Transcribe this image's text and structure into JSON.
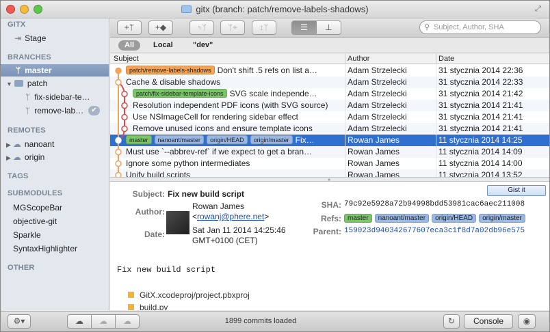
{
  "window": {
    "title": "gitx (branch: patch/remove-labels-shadows)"
  },
  "sidebar": {
    "app_header": "GITX",
    "stage": "Stage",
    "branches_header": "BRANCHES",
    "branches": [
      "master",
      "patch"
    ],
    "patch_children": [
      "fix-sidebar-te…",
      "remove-lab…"
    ],
    "remotes_header": "REMOTES",
    "remotes": [
      "nanoant",
      "origin"
    ],
    "tags_header": "TAGS",
    "submodules_header": "SUBMODULES",
    "submodules": [
      "MGScopeBar",
      "objective-git",
      "Sparkle",
      "SyntaxHighlighter"
    ],
    "other_header": "OTHER"
  },
  "search": {
    "placeholder": "Subject, Author, SHA"
  },
  "filters": {
    "all": "All",
    "local": "Local",
    "named": "\"dev\""
  },
  "columns": {
    "subject": "Subject",
    "author": "Author",
    "date": "Date"
  },
  "commits": [
    {
      "refs": [
        {
          "label": "patch/remove-labels-shadows",
          "color": "#f0a35b"
        }
      ],
      "subject": "Don't shift .5 refs on list a…",
      "author": "Adam Strzelecki",
      "date": "31 stycznia 2014 22:36"
    },
    {
      "refs": [],
      "subject": "Cache & disable shadows",
      "author": "Adam Strzelecki",
      "date": "31 stycznia 2014 22:33"
    },
    {
      "refs": [
        {
          "label": "patch/fix-sidebar-template-icons",
          "color": "#7cc46c"
        }
      ],
      "subject": "SVG scale independe…",
      "author": "Adam Strzelecki",
      "date": "31 stycznia 2014 21:42"
    },
    {
      "refs": [],
      "subject": "Resolution independent PDF icons (with SVG source)",
      "author": "Adam Strzelecki",
      "date": "31 stycznia 2014 21:41"
    },
    {
      "refs": [],
      "subject": "Use NSImageCell for rendering sidebar effect",
      "author": "Adam Strzelecki",
      "date": "31 stycznia 2014 21:41"
    },
    {
      "refs": [],
      "subject": "Remove unused icons and ensure template icons",
      "author": "Adam Strzelecki",
      "date": "31 stycznia 2014 21:41"
    },
    {
      "refs": [
        {
          "label": "master",
          "color": "#7cc46c"
        },
        {
          "label": "nanoant/master",
          "color": "#9ab8e2"
        },
        {
          "label": "origin/HEAD",
          "color": "#9ab8e2"
        },
        {
          "label": "origin/master",
          "color": "#9ab8e2"
        }
      ],
      "subject": "Fix…",
      "author": "Rowan James",
      "date": "11 stycznia 2014 14:25"
    },
    {
      "refs": [],
      "subject": "Must use `--abbrev-ref` if we expect to get a bran…",
      "author": "Rowan James",
      "date": "11 stycznia 2014 14:09"
    },
    {
      "refs": [],
      "subject": "Ignore some python intermediates",
      "author": "Rowan James",
      "date": "11 stycznia 2014 14:00"
    },
    {
      "refs": [],
      "subject": "Unify build scripts",
      "author": "Rowan James",
      "date": "11 stycznia 2014 13:52"
    }
  ],
  "detail": {
    "gist_button": "Gist it",
    "subject_label": "Subject:",
    "subject": "Fix new build script",
    "author_label": "Author:",
    "author_name": "Rowan James",
    "author_email_open": "<",
    "author_email": "rowanj@phere.net",
    "author_email_close": ">",
    "date_label": "Date:",
    "date_line1": "Sat Jan 11 2014 14:25:46",
    "date_line2": "GMT+0100 (CET)",
    "sha_label": "SHA:",
    "sha": "79c92e5928a72b94998bdd53981cac6aec211008",
    "refs_label": "Refs:",
    "refs": [
      {
        "label": "master",
        "color": "#7cc46c"
      },
      {
        "label": "nanoant/master",
        "color": "#9ab8e2"
      },
      {
        "label": "origin/HEAD",
        "color": "#9ab8e2"
      },
      {
        "label": "origin/master",
        "color": "#9ab8e2"
      }
    ],
    "parent_label": "Parent:",
    "parent": "159023d940342677607eca3c1f8d7a02db96e575",
    "message": "Fix new build script",
    "files": [
      "GitX.xcodeproj/project.pbxproj",
      "build.py"
    ]
  },
  "status": {
    "commits_loaded": "1899 commits loaded",
    "console": "Console"
  },
  "colors": {
    "selection": "#2f6fd0",
    "sidebar_bg": "#e3e8ee",
    "graph_orange": "#f0a35b",
    "graph_red": "#d84a4a",
    "ref_green": "#7cc46c",
    "ref_blue": "#9ab8e2"
  }
}
